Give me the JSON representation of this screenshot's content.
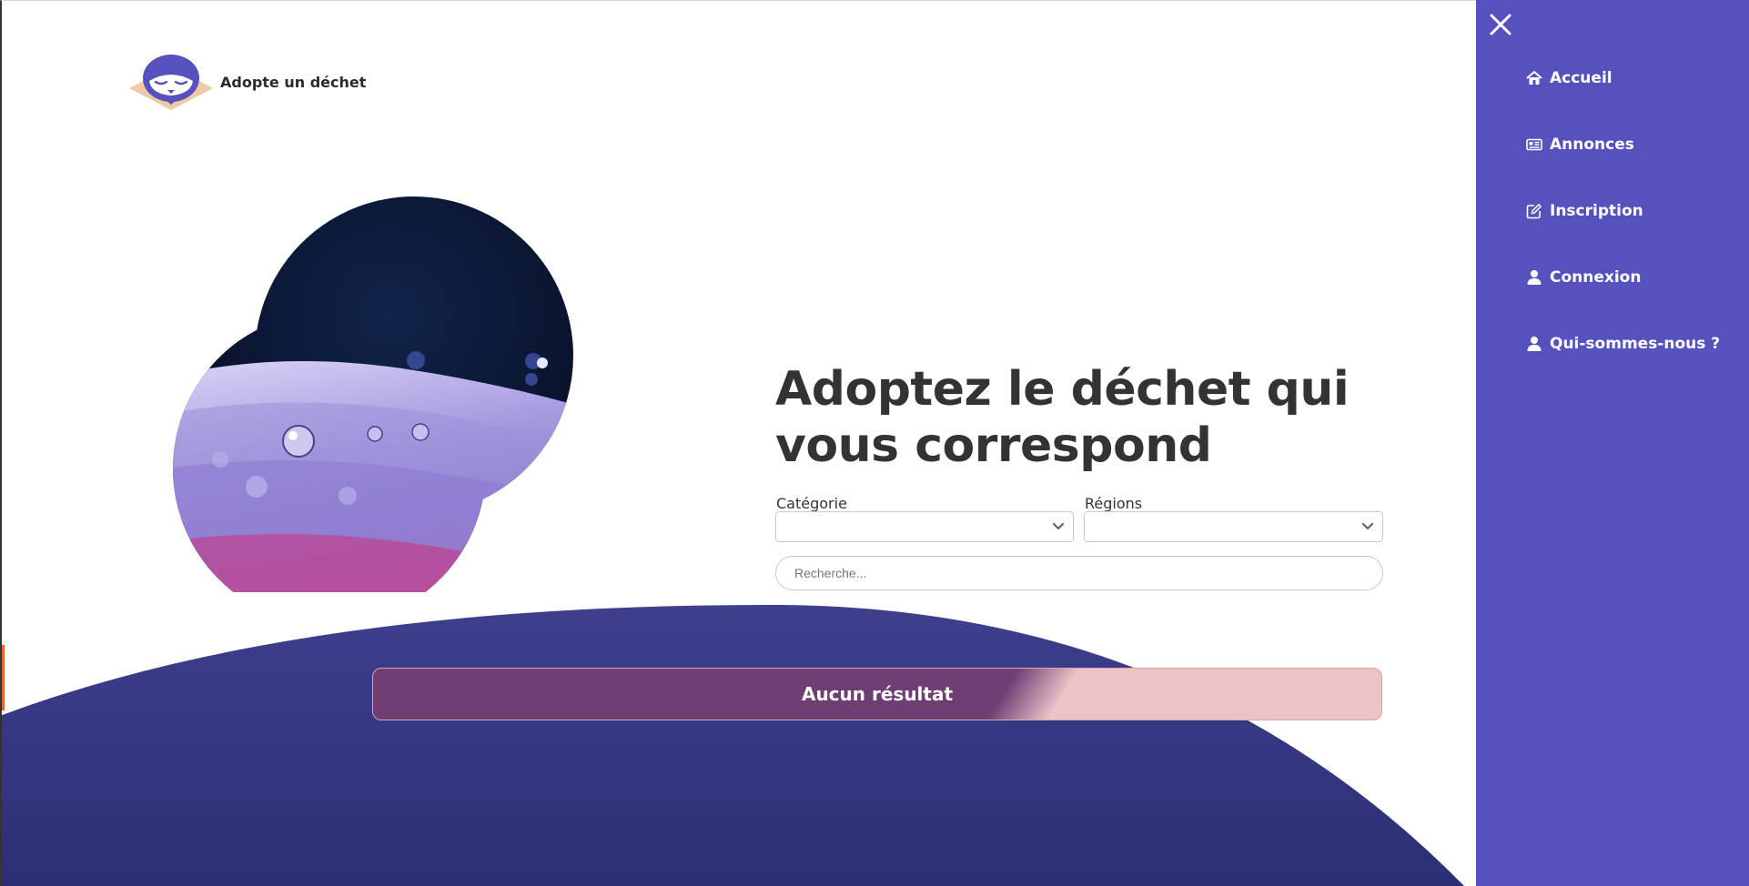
{
  "brand": {
    "name": "Adopte un déchet"
  },
  "hero": {
    "headline": "Adoptez le déchet qui vous correspond"
  },
  "filters": {
    "category_label": "Catégorie",
    "category_value": "",
    "region_label": "Régions",
    "region_value": "",
    "search_placeholder": "Recherche...",
    "search_value": ""
  },
  "results": {
    "message": "Aucun résultat"
  },
  "sidebar": {
    "close_icon": "close-icon",
    "items": [
      {
        "label": "Accueil",
        "icon": "home-icon"
      },
      {
        "label": "Annonces",
        "icon": "newspaper-icon"
      },
      {
        "label": "Inscription",
        "icon": "edit-icon"
      },
      {
        "label": "Connexion",
        "icon": "user-icon"
      },
      {
        "label": "Qui-sommes-nous ?",
        "icon": "user-icon"
      }
    ]
  },
  "colors": {
    "sidebar_bg": "#5651bd",
    "wave_dark": "#2b2e73",
    "brand_purple": "#5651bd",
    "result_banner": "#783e70"
  }
}
